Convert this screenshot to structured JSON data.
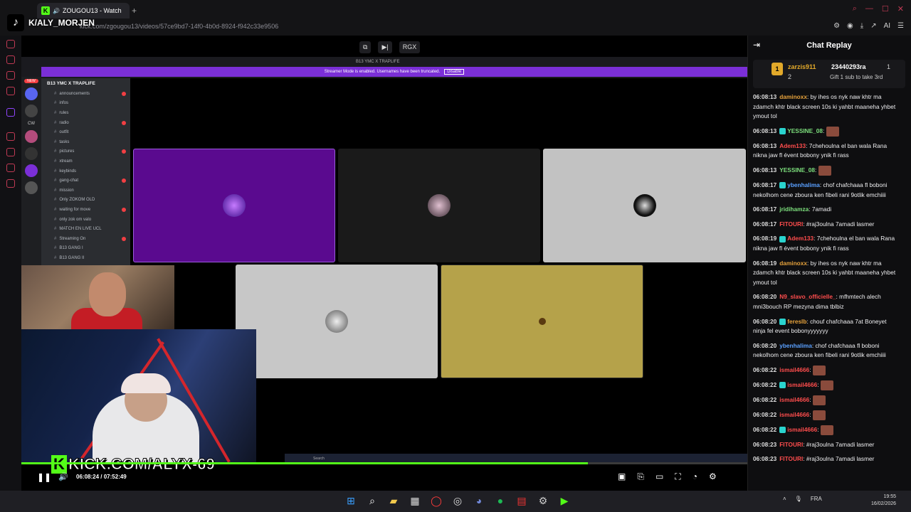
{
  "browser": {
    "tab_title": "ZOUGOU13 - Watch",
    "new_tab": "+",
    "url": "kick.com/zgougou13/videos/57ce9bd7-14f0-4b0d-8924-f942c33e9506",
    "ai_label": "AI"
  },
  "overlay": {
    "tiktok_name": "K/ALY_MORJEN",
    "kick_url": "KICK.COM/ALYX-69",
    "kick_logo": "K"
  },
  "player": {
    "current_time": "06:08:24",
    "duration": "07:52:49",
    "time_sep": "/",
    "progress": 0.78,
    "rgx_label": "RGX",
    "colors": {
      "accent": "#53fc18"
    }
  },
  "discord": {
    "window_title": "B13 YMC X TRAPLIFE",
    "banner_text": "Streamer Mode is enabled. Usernames have been truncated.",
    "banner_button": "Disable",
    "server_name": "B13 YMC X TRAPLIFE",
    "channels": [
      "announcements",
      "infos",
      "rules",
      "radio",
      "outfit",
      "tasks",
      "pictures",
      "xtream",
      "keybinds",
      "gang-chat",
      "mission",
      "Only ZOKOM OLD",
      "waiting for move",
      "only zok om valo",
      "MATCH EN LIVE UCL",
      "Streaming On",
      "B13 GANG I",
      "B13 GANG II"
    ],
    "badge_cw": "CW",
    "badge_new": "NEW",
    "search": "Search"
  },
  "chat": {
    "title": "Chat Replay",
    "pinned": {
      "rank": "1",
      "user1": "zarzis911",
      "user1_count": "2",
      "user2": "23440293ra",
      "user2_count": "1",
      "gift_text": "Gift 1 sub to take 3rd"
    },
    "messages": [
      {
        "time": "06:08:13",
        "user": "daminoxx",
        "color": "#e6a23c",
        "text": "by ihes os nyk naw khtr ma zdamch khtr black screen 10s ki yahbt maaneha yhbet ymout tol"
      },
      {
        "time": "06:08:13",
        "user": "YESSINE_08",
        "color": "#7de07d",
        "text": ""
      },
      {
        "time": "06:08:13",
        "user": "Adem133",
        "color": "#ff4d4d",
        "text": "7chehoulna el ban wala Rana nikna jaw fl évent bobony ynik fi rass"
      },
      {
        "time": "06:08:13",
        "user": "YESSINE_08",
        "color": "#7de07d",
        "text": ""
      },
      {
        "time": "06:08:17",
        "user": "ybenhalima",
        "color": "#5aa0ff",
        "text": "chof chafchaaa fl boboni nekolhom cene zboura ken fibeli rani 9otlik emchiiii"
      },
      {
        "time": "06:08:17",
        "user": "jridihamza",
        "color": "#7de07d",
        "text": "7amadi"
      },
      {
        "time": "06:08:17",
        "user": "FITOURI",
        "color": "#ff4d4d",
        "text": "#raj3oulna 7amadi lasmer"
      },
      {
        "time": "06:08:19",
        "user": "Adem133",
        "color": "#ff4d4d",
        "text": "7chehoulna el ban wala Rana nikna jaw fl évent bobony ynik fi rass"
      },
      {
        "time": "06:08:19",
        "user": "daminoxx",
        "color": "#e6a23c",
        "text": "by ihes os nyk naw khtr ma zdamch khtr black screen 10s ki yahbt maaneha yhbet ymout tol"
      },
      {
        "time": "06:08:20",
        "user": "N9_slavo_officielle_",
        "color": "#ff4d4d",
        "text": "mfhmtech alech mni3bouch RP mezyna dima tblbiz"
      },
      {
        "time": "06:08:20",
        "user": "fereslb",
        "color": "#e6a23c",
        "text": "chouf chafchaaa 7at Boneyet ninja fel event bobonyyyyyyy"
      },
      {
        "time": "06:08:20",
        "user": "ybenhalima",
        "color": "#5aa0ff",
        "text": "chof chafchaaa fl boboni nekolhom cene zboura ken fibeli rani 9otlik emchiiii"
      },
      {
        "time": "06:08:22",
        "user": "ismail4666",
        "color": "#ff4d4d",
        "text": ""
      },
      {
        "time": "06:08:22",
        "user": "ismail4666",
        "color": "#ff4d4d",
        "text": ""
      },
      {
        "time": "06:08:22",
        "user": "ismail4666",
        "color": "#ff4d4d",
        "text": ""
      },
      {
        "time": "06:08:22",
        "user": "ismail4666",
        "color": "#ff4d4d",
        "text": ""
      },
      {
        "time": "06:08:22",
        "user": "ismail4666",
        "color": "#ff4d4d",
        "text": ""
      },
      {
        "time": "06:08:23",
        "user": "FITOURI",
        "color": "#ff4d4d",
        "text": "#raj3oulna 7amadi lasmer"
      },
      {
        "time": "06:08:23",
        "user": "FITOURI",
        "color": "#ff4d4d",
        "text": "#raj3oulna 7amadi lasmer"
      }
    ]
  },
  "taskbar": {
    "lang": "FRA",
    "time": "19:55",
    "date": "16/02/2026"
  }
}
